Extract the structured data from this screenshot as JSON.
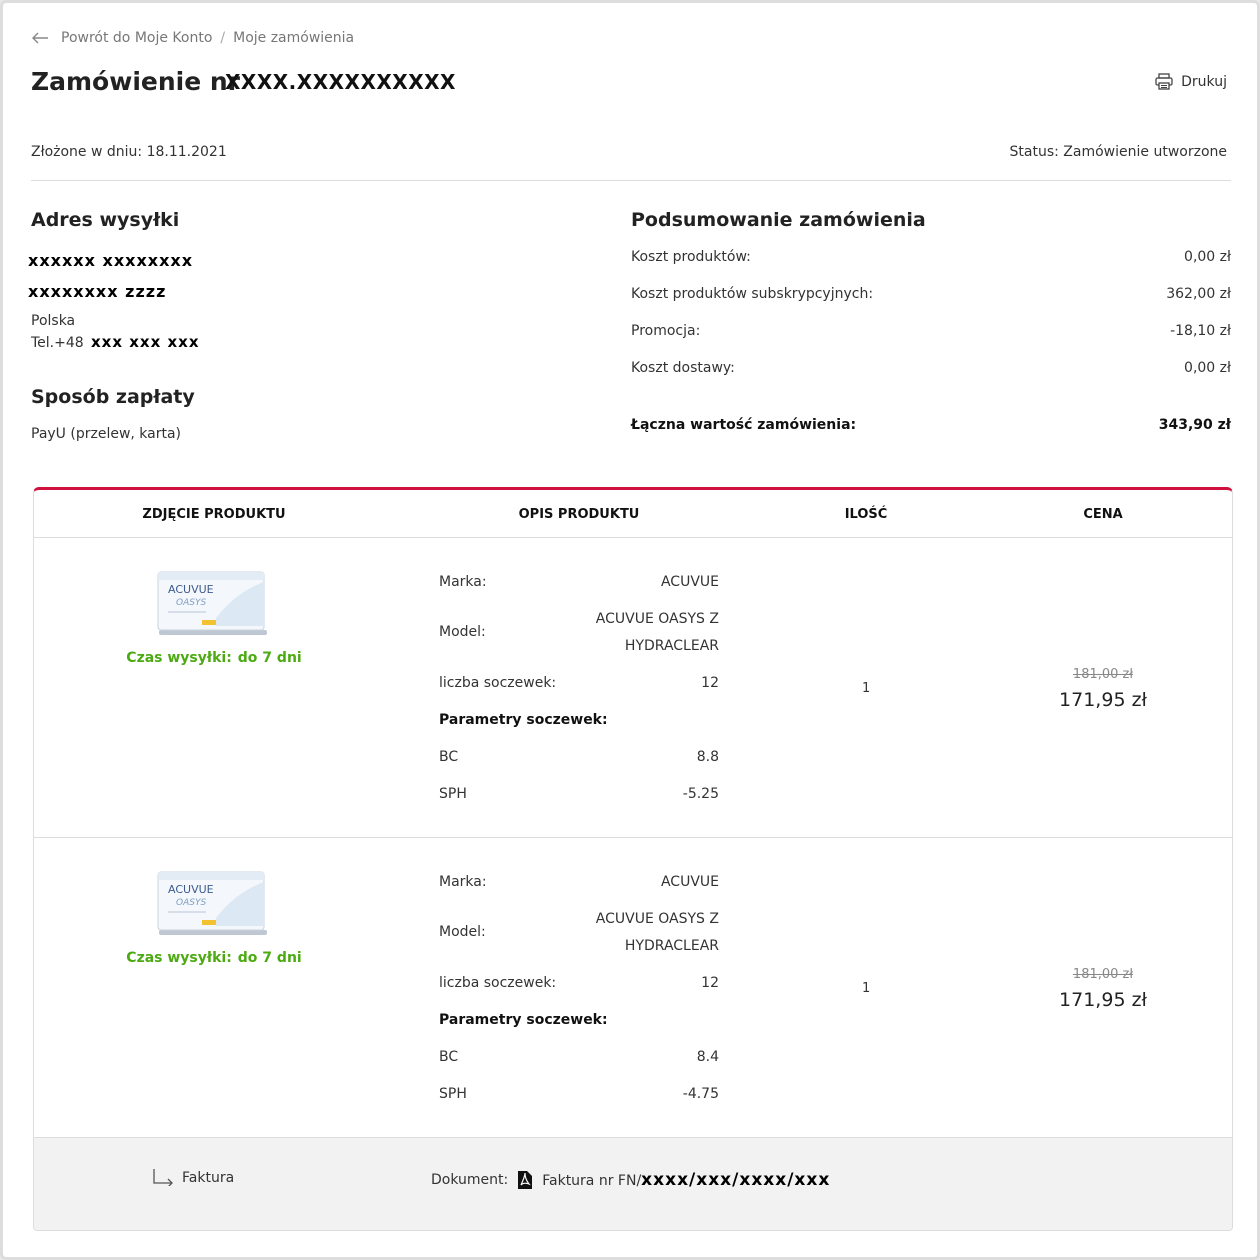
{
  "breadcrumb": {
    "back": "Powrót do Moje Konto",
    "separator": "/",
    "current": "Moje zamówienia"
  },
  "header": {
    "title": "Zamówienie nr",
    "order_no": "XXXX.XXXXXXXXXX",
    "print": "Drukuj"
  },
  "meta": {
    "placed": "Złożone w dniu: 18.11.2021",
    "status": "Status: Zamówienie utworzone"
  },
  "address": {
    "heading": "Adres wysyłki",
    "line1": "xxxxxx xxxxxxxx",
    "line2": "xxxxxxxx zzzz",
    "country": "Polska",
    "tel_prefix": "Tel.+48",
    "tel": "xxx xxx xxx"
  },
  "payment": {
    "heading": "Sposób zapłaty",
    "method": "PayU (przelew, karta)"
  },
  "summary": {
    "heading": "Podsumowanie zamówienia",
    "rows": [
      {
        "label": "Koszt produktów:",
        "value": "0,00 zł"
      },
      {
        "label": "Koszt produktów subskrypcyjnych:",
        "value": "362,00 zł"
      },
      {
        "label": "Promocja:",
        "value": "-18,10 zł"
      },
      {
        "label": "Koszt dostawy:",
        "value": "0,00 zł"
      }
    ],
    "total_label": "Łączna wartość zamówienia:",
    "total_value": "343,90 zł"
  },
  "table": {
    "headers": [
      "ZDJĘCIE PRODUKTU",
      "OPIS PRODUKTU",
      "ILOŚĆ",
      "CENA"
    ],
    "products": [
      {
        "ship_label": "Czas wysyłki:",
        "ship_value": "do 7 dni",
        "brand_label": "Marka:",
        "brand": "ACUVUE",
        "model_label": "Model:",
        "model_1": "ACUVUE OASYS Z",
        "model_2": "HYDRACLEAR",
        "lens_label": "liczba soczewek:",
        "lens": "12",
        "params_label": "Parametry soczewek:",
        "bc_label": "BC",
        "bc": "8.8",
        "sph_label": "SPH",
        "sph": "-5.25",
        "qty": "1",
        "old_price": "181,00 zł",
        "price": "171,95 zł"
      },
      {
        "ship_label": "Czas wysyłki:",
        "ship_value": "do 7 dni",
        "brand_label": "Marka:",
        "brand": "ACUVUE",
        "model_label": "Model:",
        "model_1": "ACUVUE OASYS Z",
        "model_2": "HYDRACLEAR",
        "lens_label": "liczba soczewek:",
        "lens": "12",
        "params_label": "Parametry soczewek:",
        "bc_label": "BC",
        "bc": "8.4",
        "sph_label": "SPH",
        "sph": "-4.75",
        "qty": "1",
        "old_price": "181,00 zł",
        "price": "171,95 zł"
      }
    ]
  },
  "invoice": {
    "label": "Faktura",
    "doc_label": "Dokument:",
    "doc_prefix": "Faktura nr FN/",
    "doc_no": "xxxx/xxx/xxxx/xxx"
  },
  "product_box": {
    "brand_text": "ACUVUE",
    "line_text": "OASYS"
  },
  "colors": {
    "accent": "#d0113d",
    "shipping": "#4caa12",
    "muted": "#777777"
  },
  "icons": [
    "arrow-left-icon",
    "printer-icon",
    "return-arrow-icon",
    "pdf-icon"
  ]
}
